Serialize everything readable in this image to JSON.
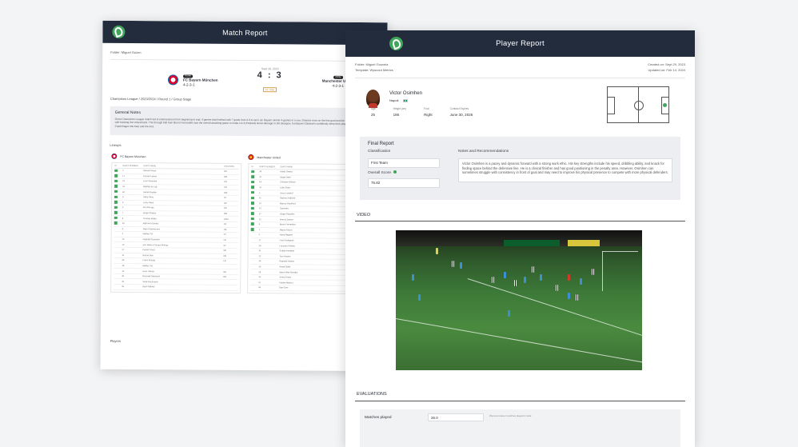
{
  "match_report": {
    "title": "Match Report",
    "folder": "Folder: Miguel Guzen",
    "home": {
      "tag": "Home",
      "name": "FC Bayern München",
      "formation": "4-2-3-1"
    },
    "away": {
      "tag": "Away",
      "name": "Manchester United",
      "formation": "4-2-3-1"
    },
    "date": "Sept 30, 2023",
    "score": "4 : 3",
    "status": "FT Time",
    "competition": "Champions League / 2023/2024 / Round 1 / Group Stage",
    "general_notes": {
      "heading": "General Notes",
      "text": "Great Champions League match full of entertainment from beginning to end. 4 games that finished with 7 goals from 4-3 to set it up. Bayern winner 4 games in a row. Onana's error on the first goal and the tenacity of G. Zirkzee it's with backing the United back. The through ball from Bruno Fernandes and the overall attacking game to make it 4-3 (Hojlund) Great damage to the Glasgow, but Bayern Dardine's confidently keep their players deck with Copenhagen the best and the end."
    },
    "lineups_label": "Lineups",
    "home_lineup": {
      "team": "FC Bayern München",
      "columns": [
        "XI",
        "SHIRT NUMBER",
        "SHIRT NAME",
        "POSITION"
      ],
      "rows": [
        {
          "starter": true,
          "number": "1",
          "name": "Manuel Neuer",
          "pos": "GK"
        },
        {
          "starter": true,
          "number": "17",
          "name": "Konrad Laimer",
          "pos": "DM"
        },
        {
          "starter": true,
          "number": "22",
          "name": "Leon Goretzka",
          "pos": "CB"
        },
        {
          "starter": true,
          "number": "23",
          "name": "Matthijs de Ligt",
          "pos": "CB"
        },
        {
          "starter": true,
          "number": "42",
          "name": "Jamal Musiala",
          "pos": "RW"
        },
        {
          "starter": true,
          "number": "9",
          "name": "Harry Kane",
          "pos": "ST"
        },
        {
          "starter": true,
          "number": "6",
          "name": "Leroy Sané",
          "pos": "LW"
        },
        {
          "starter": true,
          "number": "3",
          "name": "Kim Min-jae",
          "pos": "CB"
        },
        {
          "starter": true,
          "number": "7",
          "name": "Serge Gnabry",
          "pos": "RW"
        },
        {
          "starter": true,
          "number": "8",
          "name": "Thomas Müller",
          "pos": "CAM"
        },
        {
          "starter": true,
          "number": "19",
          "name": "Alphonso Davies",
          "pos": "LB"
        },
        {
          "starter": false,
          "number": "4",
          "name": "Dayot Upamecano",
          "pos": "CB"
        },
        {
          "starter": false,
          "number": "2",
          "name": "Mathys Tel",
          "pos": "ST"
        },
        {
          "starter": false,
          "number": "20",
          "name": "Raphaël Guerreiro",
          "pos": "LB"
        },
        {
          "starter": false,
          "number": "10",
          "name": "Eric Maxim Choupo-Moting",
          "pos": "ST"
        },
        {
          "starter": false,
          "number": "27",
          "name": "Daniel Peretz",
          "pos": "GK"
        },
        {
          "starter": false,
          "number": "11",
          "name": "Bouna Sarr",
          "pos": "RB"
        },
        {
          "starter": false,
          "number": "39",
          "name": "Frans Krätzig",
          "pos": "LB"
        },
        {
          "starter": false,
          "number": "18",
          "name": "Mathys Tel",
          "pos": ""
        },
        {
          "starter": false,
          "number": "16",
          "name": "Sven Ulreich",
          "pos": "GK"
        },
        {
          "starter": false,
          "number": "40",
          "name": "Noussair Mazraoui",
          "pos": "RB"
        },
        {
          "starter": false,
          "number": "23",
          "name": "Tarek Buchmann",
          "pos": ""
        },
        {
          "starter": false,
          "number": "45",
          "name": "Ryan Gabriel",
          "pos": ""
        }
      ]
    },
    "away_lineup": {
      "team": "Manchester United",
      "columns": [
        "XI",
        "SHIRT NUMBER",
        "SHIRT NAME",
        "POSITION"
      ],
      "rows": [
        {
          "starter": true,
          "number": "24",
          "name": "André Onana",
          "pos": ""
        },
        {
          "starter": true,
          "number": "20",
          "name": "Diogo Dalot",
          "pos": ""
        },
        {
          "starter": true,
          "number": "14",
          "name": "Christian Eriksen",
          "pos": ""
        },
        {
          "starter": true,
          "number": "23",
          "name": "Luke Shaw",
          "pos": ""
        },
        {
          "starter": true,
          "number": "2",
          "name": "Victor Lindelöf",
          "pos": ""
        },
        {
          "starter": true,
          "number": "11",
          "name": "Rasmus Højlund",
          "pos": ""
        },
        {
          "starter": true,
          "number": "10",
          "name": "Marcus Rashford",
          "pos": ""
        },
        {
          "starter": true,
          "number": "12",
          "name": "Casemiro",
          "pos": ""
        },
        {
          "starter": true,
          "number": "27",
          "name": "Sergio Reguilón",
          "pos": ""
        },
        {
          "starter": true,
          "number": "21",
          "name": "Antony Santos",
          "pos": ""
        },
        {
          "starter": true,
          "number": "8",
          "name": "Bruno Fernandes",
          "pos": ""
        },
        {
          "starter": true,
          "number": "7",
          "name": "Mason Mount",
          "pos": ""
        },
        {
          "starter": false,
          "number": "5",
          "name": "Harry Maguire",
          "pos": ""
        },
        {
          "starter": false,
          "number": "17",
          "name": "Fred Rodrigues",
          "pos": ""
        },
        {
          "starter": false,
          "number": "28",
          "name": "Facundo Pellistri",
          "pos": ""
        },
        {
          "starter": false,
          "number": "31",
          "name": "Sofyan Amrabat",
          "pos": ""
        },
        {
          "starter": false,
          "number": "22",
          "name": "Tom Heaton",
          "pos": ""
        },
        {
          "starter": false,
          "number": "19",
          "name": "Raphaël Varane",
          "pos": ""
        },
        {
          "starter": false,
          "number": "16",
          "name": "Amad Diallo",
          "pos": ""
        },
        {
          "starter": false,
          "number": "29",
          "name": "Aaron Wan-Bissaka",
          "pos": ""
        },
        {
          "starter": false,
          "number": "35",
          "name": "Jonny Evans",
          "pos": ""
        },
        {
          "starter": false,
          "number": "37",
          "name": "Kobbie Mainoo",
          "pos": ""
        },
        {
          "starter": false,
          "number": "43",
          "name": "Dan Gore",
          "pos": ""
        }
      ]
    },
    "players_label": "Players"
  },
  "player_report": {
    "title": "Player Report",
    "folder": "Folder: Miguel Gouveia",
    "template": "Template: Wyscout Metrics",
    "created": "Created on: Sept 29, 2023",
    "updated": "Updated on: Feb 14, 2024",
    "player_name": "Victor Osimhen",
    "club": "Napoli",
    "stats": [
      {
        "label": "Age",
        "value": "25"
      },
      {
        "label": "Height (cm)",
        "value": "186"
      },
      {
        "label": "Foot",
        "value": "Right"
      },
      {
        "label": "Contract Expires",
        "value": "June 30, 2026"
      }
    ],
    "final_report": {
      "heading": "Final Report",
      "classification_label": "Classification",
      "classification_value": "First Team",
      "overall_label": "Overall Score",
      "overall_value": "75.82",
      "notes_label": "Notes and Recommendations",
      "notes_text": "Victor Osimhen is a pacey and dynamic forward with a strong work ethic. His key strengths include his speed, dribbling ability, and knack for finding space behind the defensive line. He is a clinical finisher and has good positioning in the penalty area. However, Osimhen can sometimes struggle with consistency in front of goal and may need to improve his physical presence to compete with more physical defenders."
    },
    "video_label": "VIDEO",
    "evaluations_label": "EVALUATIONS",
    "evaluation": {
      "label": "Matches played",
      "value": "26.0",
      "hint": "Wyscout career matches played in total"
    }
  },
  "colors": {
    "topbar": "#222c3d",
    "accent": "#3fa65b",
    "panel": "#eceef1"
  }
}
